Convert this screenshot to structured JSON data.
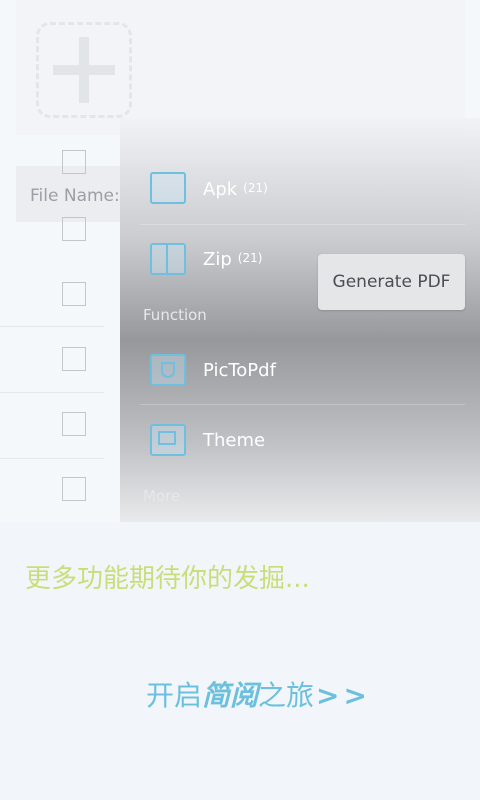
{
  "filename_label": "File Name:",
  "generate_button": "Generate PDF",
  "menu": {
    "items": [
      {
        "label": "Apk",
        "count": "(21)"
      },
      {
        "label": "Zip",
        "count": "(21)"
      }
    ],
    "function_section": "Function",
    "function_items": [
      {
        "label": "PicToPdf"
      },
      {
        "label": "Theme"
      }
    ],
    "more_section": "More"
  },
  "promo_text": "更多功能期待你的发掘...",
  "start_prefix": "开启",
  "start_brand": "简阅",
  "start_suffix": "之旅",
  "start_arrows": ">>",
  "colors": {
    "accent_green": "#c9de7a",
    "accent_blue": "#6cc0dd"
  },
  "icons": [
    "add-file-icon",
    "apk-icon",
    "zip-icon",
    "pictopdf-icon",
    "theme-icon"
  ]
}
